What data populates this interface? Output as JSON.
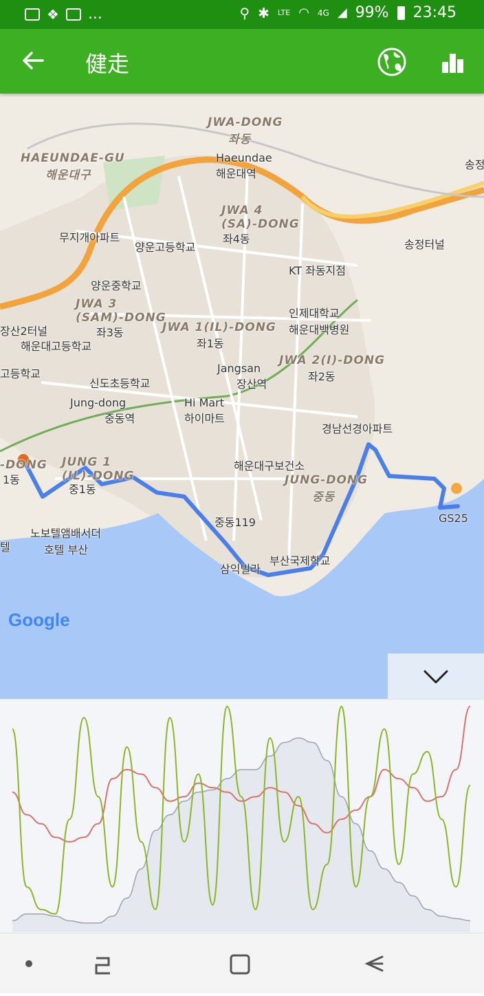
{
  "status_bar": {
    "battery": "99%",
    "time": "23:45",
    "overflow": "...",
    "network": "4G",
    "volte": "LTE",
    "icons": [
      "image-icon",
      "dropbox-icon",
      "image-icon",
      "location-icon",
      "bluetooth-icon",
      "wifi-icon",
      "signal-icon",
      "battery-icon"
    ]
  },
  "app_bar": {
    "title": "健走",
    "icons": [
      "back-arrow-icon",
      "globe-icon",
      "bar-chart-icon"
    ]
  },
  "map": {
    "attribution": "Google",
    "labels": [
      {
        "id": "jwa-dong",
        "text": "JWA-DONG",
        "sub": "좌동"
      },
      {
        "id": "haeundae-gu",
        "text": "HAEUNDAE-GU",
        "sub": "해운대구"
      },
      {
        "id": "haeundae-station",
        "text": "Haeundae",
        "sub": "해운대역"
      },
      {
        "id": "jwa4",
        "text": "JWA 4",
        "sub": "(SA)-DONG"
      },
      {
        "id": "jwa4-ko",
        "text": "좌4동"
      },
      {
        "id": "mujigae",
        "text": "무지개아파트"
      },
      {
        "id": "yangun-high",
        "text": "양운고등학교"
      },
      {
        "id": "kt",
        "text": "KT 좌동지점"
      },
      {
        "id": "songjeong",
        "text": "송정터널"
      },
      {
        "id": "song",
        "text": "송정"
      },
      {
        "id": "yangun-middle",
        "text": "양운중학교"
      },
      {
        "id": "jwa3",
        "text": "JWA 3",
        "sub": "(SAM)-DONG"
      },
      {
        "id": "jwa3-ko",
        "text": "좌3동"
      },
      {
        "id": "inje",
        "text": "인제대학교",
        "sub": "해운대백병원"
      },
      {
        "id": "jangsan-terminal",
        "text": "장산2터널"
      },
      {
        "id": "haeundae-high",
        "text": "해운대고등학교"
      },
      {
        "id": "jwa1",
        "text": "JWA 1(IL)-DONG"
      },
      {
        "id": "jwa1-ko",
        "text": "좌1동"
      },
      {
        "id": "jangsan",
        "text": "Jangsan",
        "sub": "장산역"
      },
      {
        "id": "jwa2",
        "text": "JWA 2(I)-DONG"
      },
      {
        "id": "jwa2-ko",
        "text": "좌2동"
      },
      {
        "id": "high-left",
        "text": "고등학교"
      },
      {
        "id": "sindo",
        "text": "신도초등학교"
      },
      {
        "id": "jung-dong-stn",
        "text": "Jung-dong",
        "sub": "중동역"
      },
      {
        "id": "himart",
        "text": "Hi Mart",
        "sub": "하이마트"
      },
      {
        "id": "gyeongnam",
        "text": "경남선경아파트"
      },
      {
        "id": "health",
        "text": "해운대구보건소"
      },
      {
        "id": "dong-left",
        "text": "-DONG"
      },
      {
        "id": "dong-left-ko",
        "text": "1동"
      },
      {
        "id": "jung1",
        "text": "JUNG 1",
        "sub": "(IL)-DONG"
      },
      {
        "id": "jung1-ko",
        "text": "중1동"
      },
      {
        "id": "jung-dong",
        "text": "JUNG-DONG",
        "sub": "중동"
      },
      {
        "id": "jungdong119",
        "text": "중동119"
      },
      {
        "id": "gs25",
        "text": "GS25"
      },
      {
        "id": "novotel",
        "text": "노보텔앰배서더",
        "sub": "호텔 부산"
      },
      {
        "id": "tel",
        "text": "텔"
      },
      {
        "id": "samik",
        "text": "삼익빌라"
      },
      {
        "id": "busan-intl",
        "text": "부산국제학교"
      }
    ],
    "colors": {
      "route": "#4a7ee8",
      "start": "#e06a1e",
      "end": "#f5a742",
      "sea": "#a8c8f7",
      "land": "#f1ece3"
    }
  },
  "chart_data": {
    "type": "line",
    "title": "",
    "xlabel": "",
    "ylabel": "",
    "x": [
      0,
      1,
      2,
      3,
      4,
      5,
      6,
      7,
      8,
      9,
      10,
      11,
      12,
      13,
      14,
      15,
      16,
      17,
      18,
      19,
      20,
      21,
      22,
      23,
      24,
      25,
      26,
      27,
      28,
      29,
      30,
      31,
      32
    ],
    "series": [
      {
        "values": [
          5,
          8,
          8,
          7,
          5,
          4,
          4,
          7,
          15,
          28,
          45,
          52,
          58,
          62,
          63,
          68,
          72,
          72,
          78,
          84,
          86,
          84,
          76,
          60,
          48,
          36,
          28,
          22,
          16,
          10,
          7,
          6,
          5
        ]
      },
      {
        "values": [
          62,
          52,
          48,
          42,
          40,
          42,
          48,
          68,
          72,
          70,
          64,
          58,
          60,
          66,
          64,
          62,
          58,
          60,
          64,
          62,
          56,
          48,
          44,
          50,
          54,
          60,
          72,
          68,
          64,
          58,
          60,
          72,
          100
        ]
      },
      {
        "values": [
          90,
          20,
          10,
          8,
          50,
          95,
          60,
          20,
          82,
          40,
          10,
          95,
          40,
          70,
          12,
          100,
          60,
          10,
          86,
          40,
          60,
          10,
          30,
          100,
          20,
          60,
          90,
          30,
          70,
          80,
          50,
          20,
          65
        ]
      }
    ],
    "colors": [
      "#c7cfd9",
      "#d9726a",
      "#8cb526"
    ],
    "grid": false,
    "legend": "none"
  },
  "collapse_icon": "chevron-down-icon",
  "nav_bar": {
    "icons": [
      "dot-icon",
      "recent-apps-icon",
      "home-icon",
      "back-icon"
    ]
  }
}
